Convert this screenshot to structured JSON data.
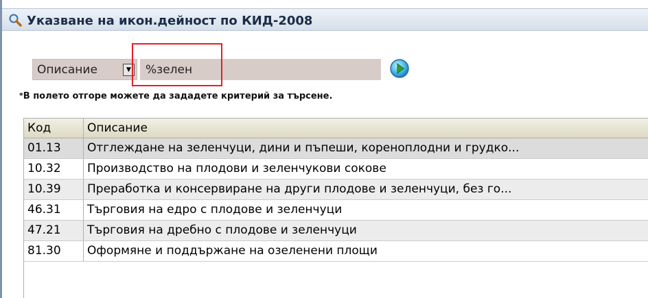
{
  "dialog": {
    "title": "Указване на икон.дейност по КИД-2008",
    "title_icon": "search-icon"
  },
  "search": {
    "field_selector": "Описание",
    "query": "%зелен",
    "go_icon": "play-arrow-icon",
    "hint_star": "*",
    "hint": "В полето отгоре можете да зададете критерий за търсене."
  },
  "table": {
    "columns": [
      "Код",
      "Описание"
    ],
    "rows": [
      {
        "code": "01.13",
        "description": "Отглеждане на зеленчуци, дини и пъпеши, кореноплодни и грудко..."
      },
      {
        "code": "10.32",
        "description": "Производство на плодови и зеленчукови сокове"
      },
      {
        "code": "10.39",
        "description": "Преработка и консервиране на други плодове и зеленчуци, без го..."
      },
      {
        "code": "46.31",
        "description": "Търговия на едро с плодове и зеленчуци"
      },
      {
        "code": "47.21",
        "description": "Търговия на дребно с плодове и зеленчуци"
      },
      {
        "code": "81.30",
        "description": "Оформяне и поддържане на озеленени площи"
      }
    ]
  },
  "colors": {
    "highlight": "#e51e25",
    "title_text": "#1b2d47",
    "input_bg": "#d8ccc8"
  }
}
